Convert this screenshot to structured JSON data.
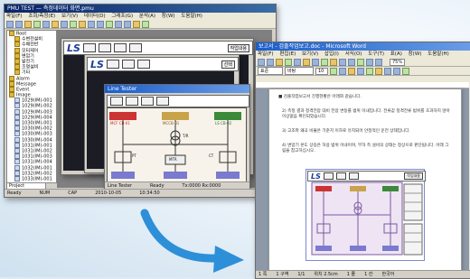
{
  "main_window": {
    "title": "PMU TEST — 측정데이터 화면.pmu",
    "menu": [
      "파일(F)",
      "조회/측정(E)",
      "보기(V)",
      "데이터(D)",
      "그래프(G)",
      "분석(A)",
      "창(W)",
      "도움말(H)"
    ],
    "tree_items": [
      "Root",
      "수변전설비",
      "수배전반",
      "모터제어",
      "변압기",
      "발전기",
      "조명설비",
      "기타",
      "Alarm",
      "Message",
      "Event",
      "Image",
      "1029(IM)-001",
      "1029(IM)-002",
      "1029(IM)-003",
      "1029(IM)-004",
      "1030(IM)-001",
      "1030(IM)-002",
      "1030(IM)-003",
      "1030(IM)-004",
      "1031(IM)-001",
      "1031(IM)-002",
      "1031(IM)-003",
      "1031(IM)-004",
      "1032(IM)-001",
      "1032(IM)-002",
      "1033(IM)-001"
    ],
    "tree_tab": "Project",
    "status": [
      "Ready",
      "NUM",
      "CAP",
      "2010-10-05",
      "10:34:50"
    ]
  },
  "ls_window": {
    "title": "Line Tester",
    "logo": "LS",
    "right_button": "작업내용",
    "sub_button": "선택",
    "labels": [
      "MCF CB-01",
      "MCCB-01",
      "T/R",
      "LS CB-02",
      "PT",
      "CT",
      "MOF",
      "VCB",
      "LA",
      "ACB",
      "MCF",
      "PT-01",
      "PT-02",
      "MTR",
      "GEN",
      "LOAD-1",
      "LOAD-2"
    ],
    "status": [
      "Line Tester",
      "Ready",
      "Tx:0000 Rx:0000"
    ]
  },
  "word_window": {
    "title": "보고서 - 검출작업보고.doc - Microsoft Word",
    "menu": [
      "파일(F)",
      "편집(E)",
      "보기(V)",
      "삽입(I)",
      "서식(O)",
      "도구(T)",
      "표(A)",
      "창(W)",
      "도움말(H)"
    ],
    "zoom": "75%",
    "style": "표준",
    "font": "바탕",
    "size": "10",
    "paragraphs": [
      "■ 검출작업보고서 진행현황은 아래와 같습니다.",
      "2) 측정 결과 정격전압 대비 전압 변동률 범위 이내입니다. 전류값 정격전류 범위를 초과하지 않아 이상없음 확인되었습니다.",
      "3) 고조파 왜곡 비율은 기준치 이하로 유지되어 안정적인 운전 상태입니다.",
      "4) 변압기 온도 상승은 허용 범위 이내이며, 부하 측 설비의 상태는 정상으로 판단됩니다. 아래 그림을 참고하십시오."
    ],
    "status": [
      "1 쪽",
      "1 구역",
      "1/1",
      "위치 2.5cm",
      "1 줄",
      "1 칸",
      "한국어"
    ]
  },
  "colors": {
    "desktop": "#dfeaf4",
    "arrow": "#2d8fd8",
    "titlebar": "#0a246a"
  }
}
